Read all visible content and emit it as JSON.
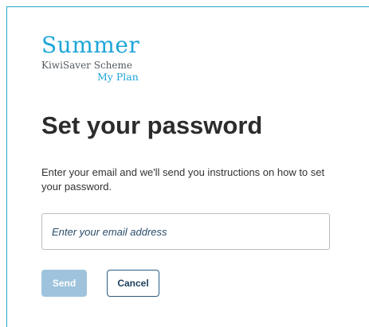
{
  "logo": {
    "name": "Summer",
    "scheme": "KiwiSaver Scheme",
    "plan": "My Plan"
  },
  "page": {
    "title": "Set your password",
    "description": "Enter your email and we'll send you instructions on how to set your password."
  },
  "form": {
    "email_value": "",
    "email_placeholder": "Enter your email address",
    "send_label": "Send",
    "cancel_label": "Cancel"
  },
  "colors": {
    "brand_blue": "#1ea6d8",
    "frame_border": "#2aa7c7",
    "send_disabled": "#9fc3dc",
    "cancel_border": "#2a5d84"
  }
}
